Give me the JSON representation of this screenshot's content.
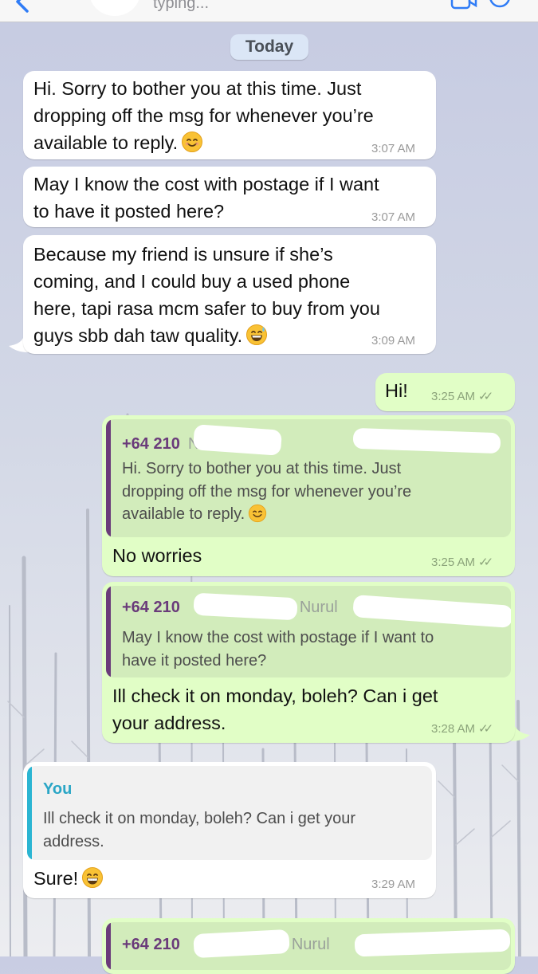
{
  "header": {
    "status": "typing...",
    "icons": [
      "back-arrow-icon",
      "video-call-icon",
      "phone-call-icon"
    ]
  },
  "date_divider": "Today",
  "colors": {
    "incoming_bubble": "#ffffff",
    "outgoing_bubble": "#e1fec6",
    "quote_bar_contact": "#6a3b7a",
    "quote_bar_self": "#2bb5d2",
    "you_label": "#2aa6c6"
  },
  "messages": [
    {
      "direction": "incoming",
      "lines": [
        "Hi. Sorry to bother you at this time. Just",
        "dropping off the msg for whenever you’re",
        "available to reply."
      ],
      "emoji": "smiling-face-icon",
      "time": "3:07 AM"
    },
    {
      "direction": "incoming",
      "lines": [
        "May I know the cost with postage if I want",
        "to have it posted here?"
      ],
      "time": "3:07 AM"
    },
    {
      "direction": "incoming",
      "lines": [
        "Because my friend is unsure if she’s",
        "coming, and I could buy a used phone",
        "here, tapi rasa mcm safer to buy from you",
        "guys sbb dah taw quality."
      ],
      "emoji": "grinning-sweat-icon",
      "time": "3:09 AM"
    },
    {
      "direction": "outgoing",
      "lines": [
        "Hi!"
      ],
      "time": "3:25 AM"
    },
    {
      "direction": "outgoing",
      "quote": {
        "sender": "+64 210",
        "name": "Nurul",
        "lines": [
          "Hi. Sorry to bother you at this time. Just",
          "dropping off the msg for whenever you’re",
          "available to reply."
        ]
      },
      "lines": [
        "No worries"
      ],
      "time": "3:25 AM"
    },
    {
      "direction": "outgoing",
      "quote": {
        "sender": "+64 210",
        "name": "Nurul",
        "lines": [
          "May I know the cost with postage if I want to",
          "have it posted here?"
        ]
      },
      "lines": [
        "Ill check it on monday, boleh? Can i get",
        "your address."
      ],
      "time": "3:28 AM"
    },
    {
      "direction": "incoming",
      "quote": {
        "sender": "You",
        "lines": [
          "Ill check it on monday, boleh? Can i get your",
          "address."
        ]
      },
      "lines": [
        "Sure!"
      ],
      "emoji": "big-grin-icon",
      "time": "3:29 AM"
    },
    {
      "direction": "outgoing",
      "quote": {
        "sender": "+64 210",
        "name": "Nurul"
      }
    }
  ]
}
